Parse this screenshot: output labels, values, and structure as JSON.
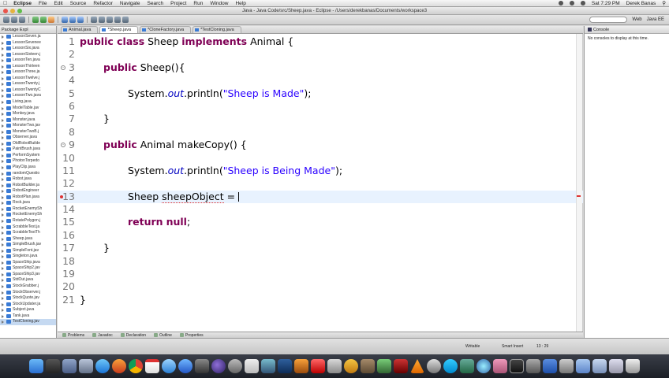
{
  "menubar": {
    "app": "Eclipse",
    "items": [
      "File",
      "Edit",
      "Source",
      "Refactor",
      "Navigate",
      "Search",
      "Project",
      "Run",
      "Window",
      "Help"
    ],
    "clock": "Sat 7:29 PM",
    "user": "Derek Banas"
  },
  "window": {
    "title": "Java - Java Code/src/Sheep.java - Eclipse - /Users/derekbanas/Documents/workspace3"
  },
  "toolbar": {
    "perspectives": [
      "Web",
      "Java EE"
    ]
  },
  "package_explorer": {
    "title": "Package Expl",
    "files": [
      "LessonSeven.ja",
      "LessonSevenee",
      "LessonSix.java",
      "LessonSixteen.j",
      "LessonTen.java",
      "LessonThirteen",
      "LessonThree.ja",
      "LessonTwelve.j",
      "LessonTwenty.j",
      "LessonTwentyC",
      "LessonTwo.java",
      "Living.java",
      "ModelTable.jav",
      "Monkey.java",
      "Monster.java",
      "MonsterTwo.jav",
      "MonsterTwoB.j",
      "Observer.java",
      "OldRobotBuilde",
      "PaintBrush.java",
      "PerformSystem",
      "PhotonTorpedo",
      "PlayClip.java",
      "randomQuestio",
      "Robot.java",
      "RobotBuilder.ja",
      "RobotEngineer",
      "RobotPlan.java",
      "Rock.java",
      "RocketEnemySh",
      "RocketEnemySh",
      "RotatePolygon.j",
      "ScrabbleTest.ja",
      "ScrabbleTestTh",
      "Sheep.java",
      "SimpleBrush.jav",
      "SimpleFont.jav",
      "Singleton.java",
      "SpaceShip.java",
      "SpaceShip2.jav",
      "SpaceShip3.jav",
      "StdOut.java",
      "StockGrabber.j",
      "StockObserver.j",
      "StockQuote.jav",
      "StockUpdater.ja",
      "Subject.java",
      "Tank.java",
      "TestCloning.jav"
    ]
  },
  "editor": {
    "tabs": [
      "Animal.java",
      "*Sheep.java",
      "*CloneFactory.java",
      "*TestCloning.java"
    ],
    "active_tab": 1,
    "lines": [
      {
        "n": "1"
      },
      {
        "n": "2"
      },
      {
        "n": "3"
      },
      {
        "n": "4"
      },
      {
        "n": "5"
      },
      {
        "n": "6"
      },
      {
        "n": "7"
      },
      {
        "n": "8"
      },
      {
        "n": "9"
      },
      {
        "n": "10"
      },
      {
        "n": "11"
      },
      {
        "n": "12"
      },
      {
        "n": "13"
      },
      {
        "n": "14"
      },
      {
        "n": "15"
      },
      {
        "n": "16"
      },
      {
        "n": "17"
      },
      {
        "n": "18"
      },
      {
        "n": "19"
      },
      {
        "n": "20"
      },
      {
        "n": "21"
      }
    ],
    "code": {
      "l1_kw1": "public class",
      "l1_rest1": " Sheep ",
      "l1_kw2": "implements",
      "l1_rest2": " Animal {",
      "l3_kw": "public",
      "l3_rest": " Sheep(){",
      "l5_a": "System.",
      "l5_out": "out",
      "l5_b": ".println(",
      "l5_str": "\"Sheep is Made\"",
      "l5_c": ");",
      "l7": "}",
      "l9_kw": "public",
      "l9_rest": " Animal makeCopy() {",
      "l11_a": "System.",
      "l11_out": "out",
      "l11_b": ".println(",
      "l11_str": "\"Sheep is Being Made\"",
      "l11_c": ");",
      "l13_a": "Sheep ",
      "l13_var": "sheepObject",
      "l13_b": " = ",
      "l15_kw": "return",
      "l15_kw2": "null",
      "l15_c": ";",
      "l17": "}",
      "l21": "}"
    }
  },
  "console": {
    "title": "Console",
    "message": "No consoles to display at this time."
  },
  "bottom_tabs": [
    "Problems",
    "Javadoc",
    "Declaration",
    "Outline",
    "Properties"
  ],
  "status": {
    "writable": "Writable",
    "insert": "Smart Insert",
    "position": "13 : 29"
  }
}
